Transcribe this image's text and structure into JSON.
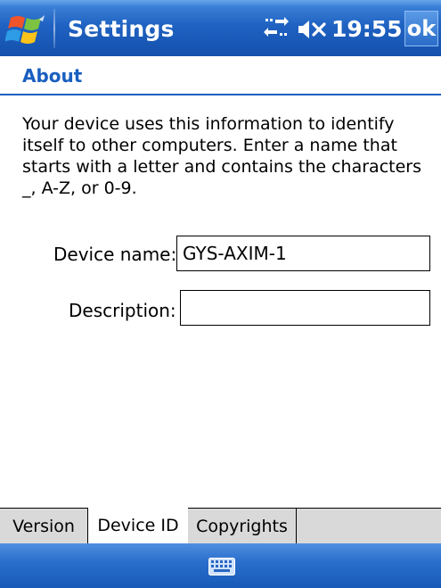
{
  "titlebar": {
    "title": "Settings",
    "time": "19:55",
    "ok_label": "ok",
    "icons": [
      "windows-start-icon",
      "connectivity-icon",
      "volume-muted-icon"
    ]
  },
  "header": {
    "label": "About"
  },
  "intro_text": "Your device uses this information to identify itself to other computers. Enter a name that starts with a letter and contains the characters _, A-Z, or 0-9.",
  "form": {
    "device_name_label": "Device name:",
    "device_name_value": "GYS-AXIM-1",
    "description_label": "Description:",
    "description_value": ""
  },
  "tabs": [
    {
      "label": "Version",
      "active": false
    },
    {
      "label": "Device ID",
      "active": true
    },
    {
      "label": "Copyrights",
      "active": false
    }
  ],
  "bottombar": {
    "icon": "keyboard-icon"
  },
  "colors": {
    "accent": "#1a5fc0",
    "titlebar": "#1f62c2"
  }
}
